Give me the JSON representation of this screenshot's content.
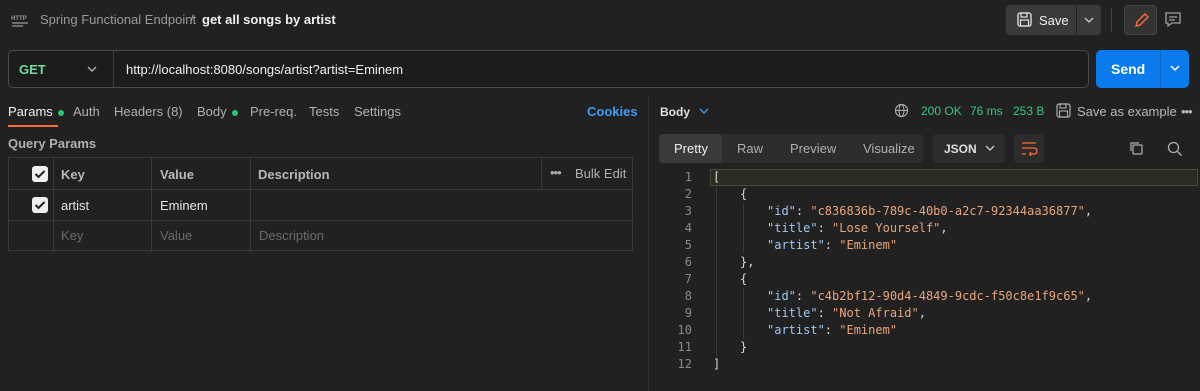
{
  "header": {
    "collection": "Spring Functional Endpoint",
    "separator": "/",
    "request_name": "get all songs by artist",
    "save_label": "Save"
  },
  "request": {
    "method": "GET",
    "url": "http://localhost:8080/songs/artist?artist=Eminem",
    "send_label": "Send"
  },
  "tabs": [
    {
      "label": "Params",
      "dot": true
    },
    {
      "label": "Auth"
    },
    {
      "label": "Headers (8)"
    },
    {
      "label": "Body",
      "dot": true
    },
    {
      "label": "Pre-req."
    },
    {
      "label": "Tests"
    },
    {
      "label": "Settings"
    }
  ],
  "cookies_label": "Cookies",
  "query_params": {
    "title": "Query Params",
    "columns": [
      "Key",
      "Value",
      "Description"
    ],
    "bulk_edit": "Bulk Edit",
    "rows": [
      {
        "key": "artist",
        "value": "Eminem",
        "checked": true
      }
    ],
    "placeholders": {
      "key": "Key",
      "value": "Value",
      "description": "Description"
    }
  },
  "response": {
    "body_label": "Body",
    "status": "200 OK",
    "time": "76 ms",
    "size": "253 B",
    "save_example": "Save as example",
    "view_tabs": [
      "Pretty",
      "Raw",
      "Preview",
      "Visualize"
    ],
    "format": "JSON",
    "lines": [
      "1",
      "2",
      "3",
      "4",
      "5",
      "6",
      "7",
      "8",
      "9",
      "10",
      "11",
      "12"
    ],
    "code": {
      "l1": "[",
      "l2": "{",
      "k_id": "\"id\"",
      "k_title": "\"title\"",
      "k_artist": "\"artist\"",
      "id1": "\"c836836b-789c-40b0-a2c7-92344aa36877\"",
      "title1": "\"Lose Yourself\"",
      "artist1": "\"Eminem\"",
      "l6": "},",
      "l7": "{",
      "id2": "\"c4b2bf12-90d4-4849-9cdc-f50c8e1f9c65\"",
      "title2": "\"Not Afraid\"",
      "artist2": "\"Eminem\"",
      "l11": "}",
      "l12": "]"
    }
  }
}
